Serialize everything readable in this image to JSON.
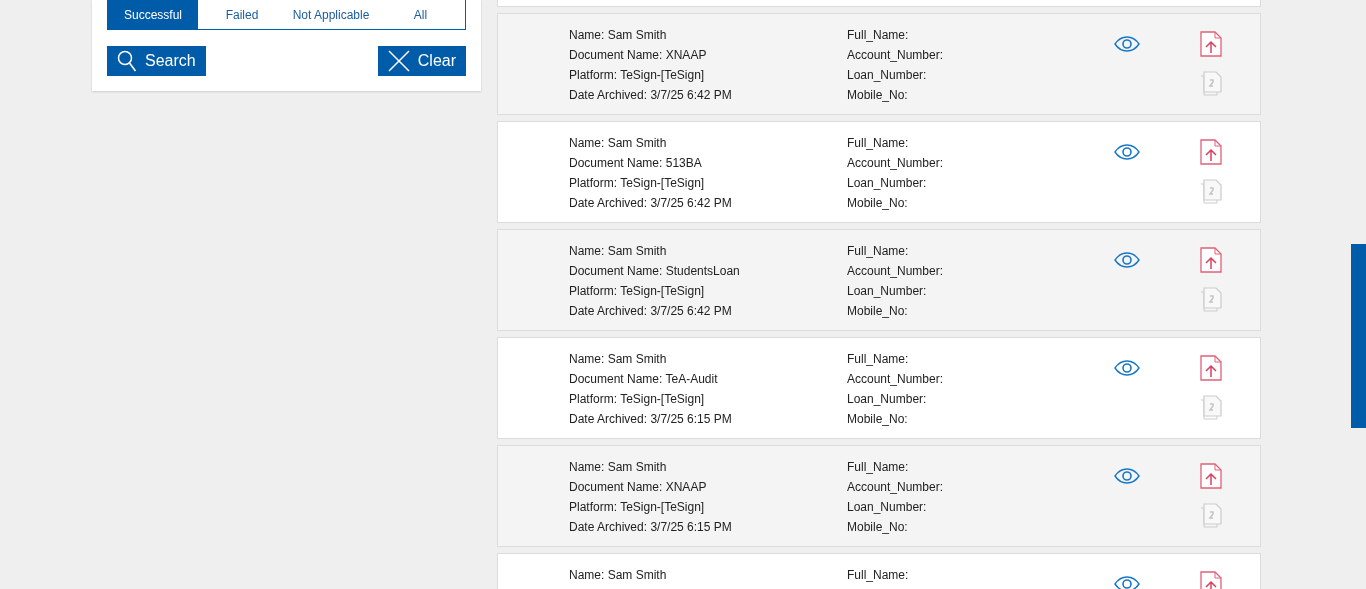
{
  "filter_tabs": [
    {
      "label": "Successful",
      "selected": true
    },
    {
      "label": "Failed",
      "selected": false
    },
    {
      "label": "Not Applicable",
      "selected": false
    },
    {
      "label": "All",
      "selected": false
    }
  ],
  "buttons": [
    {
      "kind": "search",
      "label": "Search"
    },
    {
      "kind": "clear",
      "label": "Clear"
    }
  ],
  "records": [
    {
      "left": [
        "Name: Sam Smith",
        "Document Name: XNAAP",
        "Platform: TeSign-[TeSign]",
        "Date Archived: 3/7/25 6:42 PM"
      ],
      "right": [
        "Full_Name:",
        "Account_Number:",
        "Loan_Number:",
        "Mobile_No:"
      ],
      "file_icons": [
        {
          "kind": "upload"
        },
        {
          "kind": "copies"
        }
      ]
    },
    {
      "left": [
        "Name: Sam Smith",
        "Document Name: 513BA",
        "Platform: TeSign-[TeSign]",
        "Date Archived: 3/7/25 6:42 PM"
      ],
      "right": [
        "Full_Name:",
        "Account_Number:",
        "Loan_Number:",
        "Mobile_No:"
      ],
      "file_icons": [
        {
          "kind": "upload"
        },
        {
          "kind": "copies"
        }
      ]
    },
    {
      "left": [
        "Name: Sam Smith",
        "Document Name: StudentsLoan",
        "Platform: TeSign-[TeSign]",
        "Date Archived: 3/7/25 6:42 PM"
      ],
      "right": [
        "Full_Name:",
        "Account_Number:",
        "Loan_Number:",
        "Mobile_No:"
      ],
      "file_icons": [
        {
          "kind": "upload"
        },
        {
          "kind": "copies"
        }
      ]
    },
    {
      "left": [
        "Name: Sam Smith",
        "Document Name: TeA-Audit",
        "Platform: TeSign-[TeSign]",
        "Date Archived: 3/7/25 6:15 PM"
      ],
      "right": [
        "Full_Name:",
        "Account_Number:",
        "Loan_Number:",
        "Mobile_No:"
      ],
      "file_icons": [
        {
          "kind": "upload"
        },
        {
          "kind": "copies"
        }
      ]
    },
    {
      "left": [
        "Name: Sam Smith",
        "Document Name: XNAAP",
        "Platform: TeSign-[TeSign]",
        "Date Archived: 3/7/25 6:15 PM"
      ],
      "right": [
        "Full_Name:",
        "Account_Number:",
        "Loan_Number:",
        "Mobile_No:"
      ],
      "file_icons": [
        {
          "kind": "upload"
        },
        {
          "kind": "copies"
        }
      ]
    },
    {
      "left": [
        "Name: Sam Smith"
      ],
      "right": [
        "Full_Name:"
      ],
      "file_icons": [
        {
          "kind": "upload"
        }
      ]
    }
  ]
}
